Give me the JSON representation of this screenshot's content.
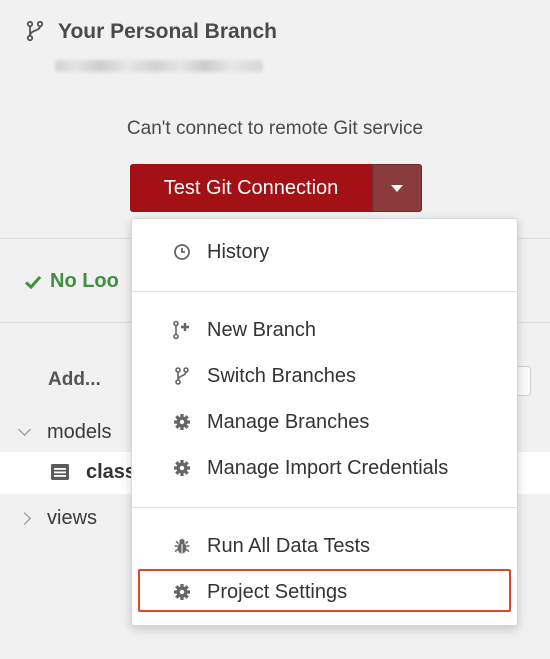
{
  "header": {
    "title": "Your Personal Branch"
  },
  "status": {
    "message": "Can't connect to remote Git service"
  },
  "git_button": {
    "label": "Test Git Connection"
  },
  "background": {
    "status_ok": "No Loo",
    "add_label": "Add...",
    "tree": {
      "folder_models": "models",
      "file_partial": "class",
      "folder_views": "views"
    }
  },
  "menu": {
    "history": "History",
    "new_branch": "New Branch",
    "switch_branches": "Switch Branches",
    "manage_branches": "Manage Branches",
    "manage_import_credentials": "Manage Import Credentials",
    "run_all_data_tests": "Run All Data Tests",
    "project_settings": "Project Settings"
  },
  "colors": {
    "button_red": "#a31015",
    "caret_bg": "#8b3b3c",
    "ok_green": "#3f8f3f",
    "highlight_border": "#e0462a"
  }
}
